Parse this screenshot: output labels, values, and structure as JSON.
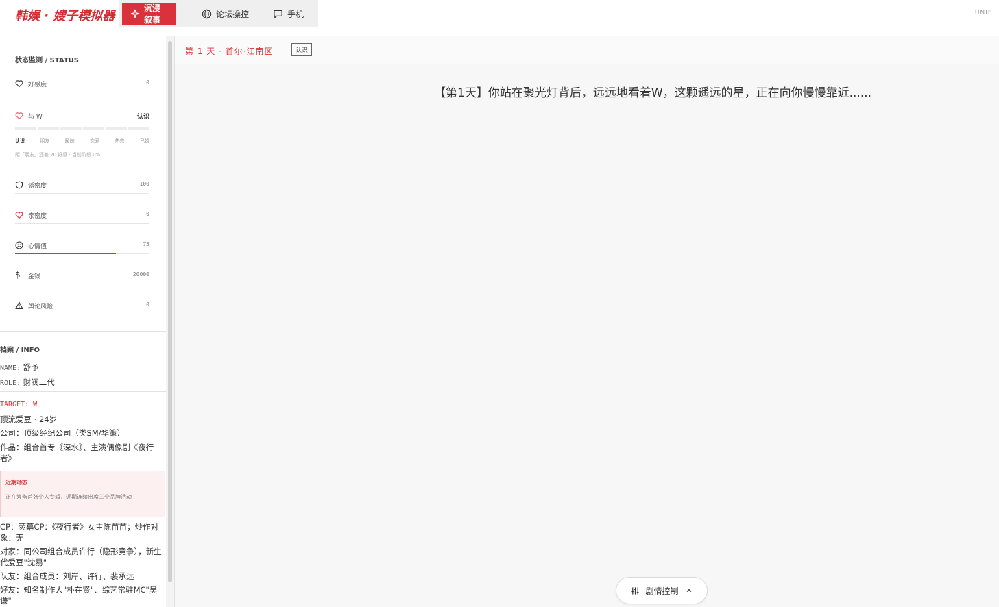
{
  "header": {
    "brand": "韩娱 · 嫂子模拟器",
    "nav": [
      {
        "label": "沉浸叙事",
        "active": true
      },
      {
        "label": "论坛操控",
        "active": false
      },
      {
        "label": "手机",
        "active": false
      }
    ],
    "right_text": "UNIF"
  },
  "sidebar": {
    "status_title": "状态监测 / STATUS",
    "stats": {
      "favor": {
        "label": "好感度",
        "value": "0"
      },
      "safety": {
        "label": "诱密度",
        "value": "100"
      },
      "intimacy": {
        "label": "亲密度",
        "value": "0"
      },
      "mood": {
        "label": "心情值",
        "value": "75"
      },
      "money": {
        "label": "金钱",
        "value": "20000"
      },
      "risk": {
        "label": "舆论风险",
        "value": "0"
      }
    },
    "relation": {
      "label": "与 W",
      "level": "认识",
      "stages": [
        "认识",
        "朋友",
        "暧昧",
        "恋爱",
        "热恋",
        "已婚"
      ],
      "hint": "距「朋友」还差 20 好感 · 当前阶段 0%"
    },
    "info_title": "档案 / INFO",
    "name_key": "NAME:",
    "name_value": "舒予",
    "role_key": "ROLE:",
    "role_value": "财阀二代",
    "target": "TARGET: W",
    "target_desc": "顶流爱豆 · 24岁",
    "company": "公司：顶级经纪公司（类SM/华策）",
    "works": "作品：组合首专《深水》、主演偶像剧《夜行者》",
    "recent_title": "近期动态",
    "recent_body": "正在筹备首张个人专辑，近期连续出席三个品牌活动",
    "cp": "CP：荧幕CP：《夜行者》女主陈苗苗；炒作对象：无",
    "rival": "对家：同公司组合成员许行（隐形竞争），新生代爱豆\"沈易\"",
    "teammates": "队友：组合成员：刘岸、许行、裴承远",
    "friends": "好友：知名制作人\"朴在贤\"、综艺常驻MC\"吴谦\""
  },
  "main": {
    "breadcrumb": "第 1 天 · 首尔·江南区",
    "tag": "认识",
    "story": "【第1天】你站在聚光灯背后，远远地看着W，这颗遥远的星，正在向你慢慢靠近......",
    "plot_control": "剧情控制"
  },
  "colors": {
    "accent": "#d9323a",
    "accent_bg": "#fdf0f1"
  },
  "levels": {
    "mood": 0.75,
    "money_bar": 1.0
  }
}
